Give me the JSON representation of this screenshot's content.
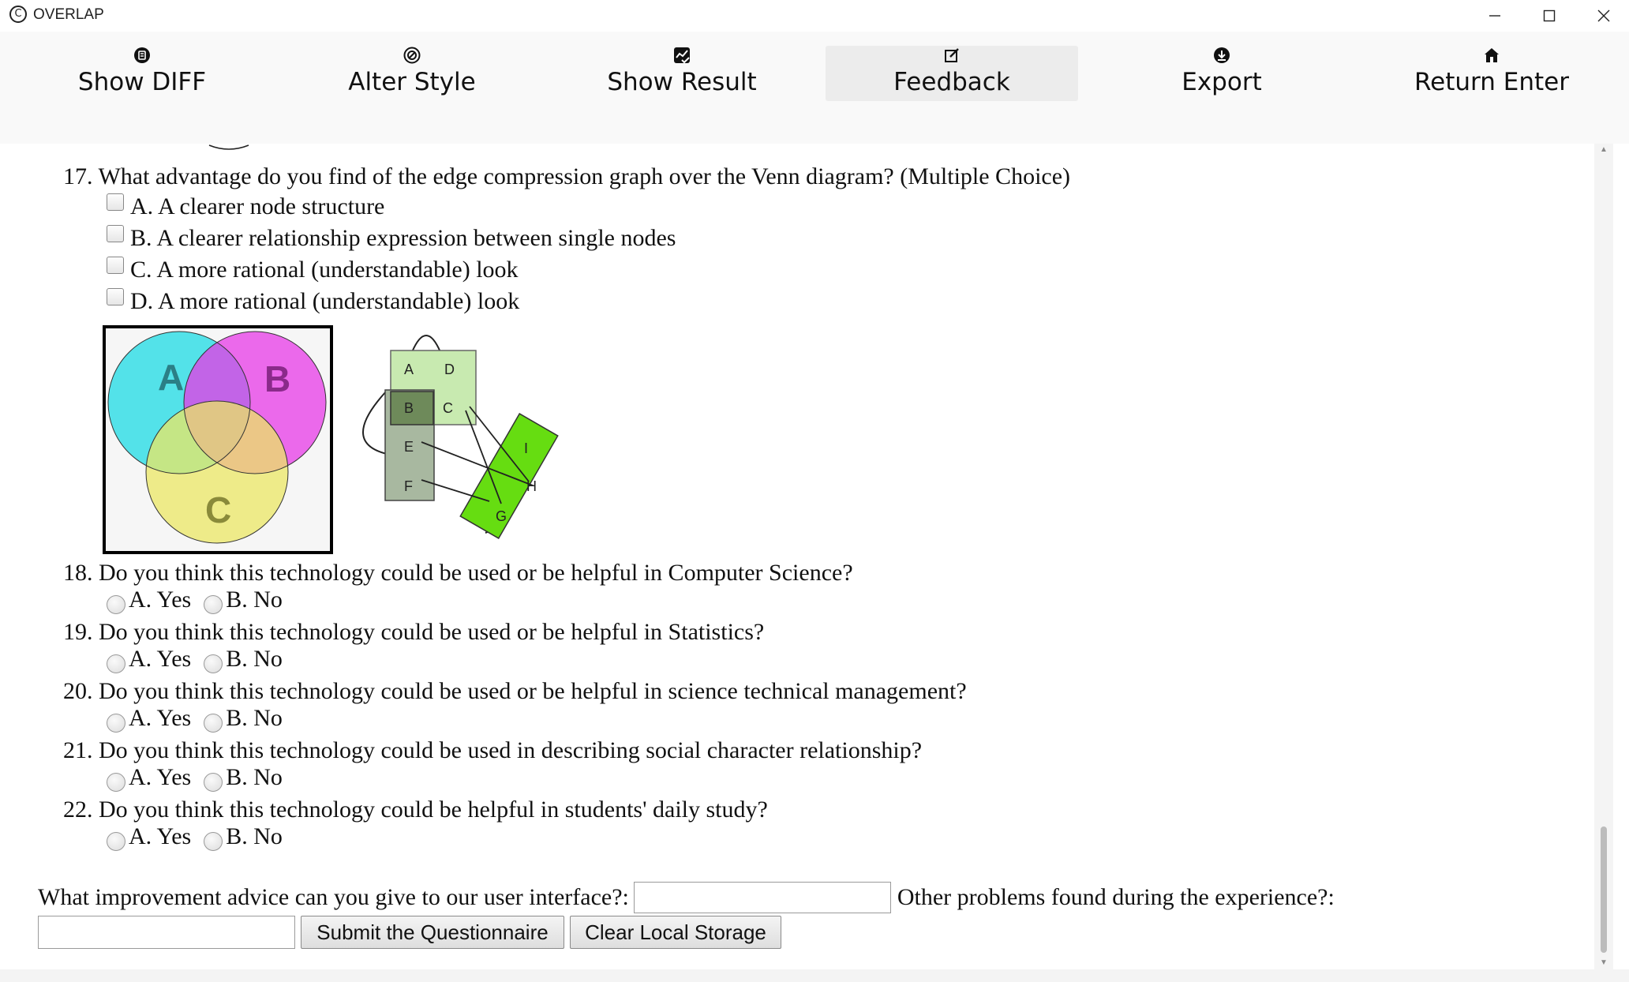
{
  "window": {
    "title": "OVERLAP",
    "app_icon_glyph": "C",
    "controls": [
      "minimize-icon",
      "maximize-icon",
      "close-icon"
    ]
  },
  "toolbar": {
    "buttons": [
      {
        "label": "Show DIFF",
        "icon": "diff-icon"
      },
      {
        "label": "Alter Style",
        "icon": "style-icon"
      },
      {
        "label": "Show Result",
        "icon": "result-icon"
      },
      {
        "label": "Feedback",
        "icon": "edit-icon",
        "active": true
      },
      {
        "label": "Export",
        "icon": "download-icon"
      },
      {
        "label": "Return Enter",
        "icon": "home-icon"
      }
    ]
  },
  "questions": {
    "q17": {
      "text": "17. What advantage do you find of the edge compression graph over the Venn diagram? (Multiple Choice)",
      "options": [
        "A. A clearer node structure",
        "B. A clearer relationship expression between single nodes",
        "C. A more rational (understandable) look",
        "D. A more rational (understandable) look"
      ],
      "venn_labels": [
        "A",
        "B",
        "C"
      ],
      "graph_labels": [
        "A",
        "D",
        "B",
        "C",
        "E",
        "F",
        "I",
        "H",
        "G"
      ]
    },
    "yes_no": [
      {
        "text": "18. Do you think this technology could be used or be helpful in Computer Science?",
        "yes": "A. Yes",
        "no": "B. No"
      },
      {
        "text": "19. Do you think this technology could be used or be helpful in Statistics?",
        "yes": "A. Yes",
        "no": "B. No"
      },
      {
        "text": "20. Do you think this technology could be used or be helpful in science technical management?",
        "yes": "A. Yes",
        "no": "B. No"
      },
      {
        "text": "21. Do you think this technology could be used in describing social character relationship?",
        "yes": "A. Yes",
        "no": "B. No"
      },
      {
        "text": "22. Do you think this technology could be helpful in students' daily study?",
        "yes": "A. Yes",
        "no": "B. No"
      }
    ]
  },
  "feedback": {
    "ui_advice_label": "What improvement advice can you give to our user interface?:",
    "ui_advice_value": "",
    "other_problems_label": "Other problems found during the experience?:",
    "other_problems_value": "",
    "submit_label": "Submit the Questionnaire",
    "clear_label": "Clear Local Storage"
  },
  "colors": {
    "toolbar_bg": "#f9f9f9",
    "active_tab_bg": "#ececec",
    "venn_a": "#38e8f0",
    "venn_b": "#f03cf0",
    "venn_c": "#f4f068",
    "graph_light": "#c8eab0",
    "graph_dark": "#6e8a5a",
    "graph_gray": "#a8b8a0",
    "graph_green": "#66dd11"
  }
}
